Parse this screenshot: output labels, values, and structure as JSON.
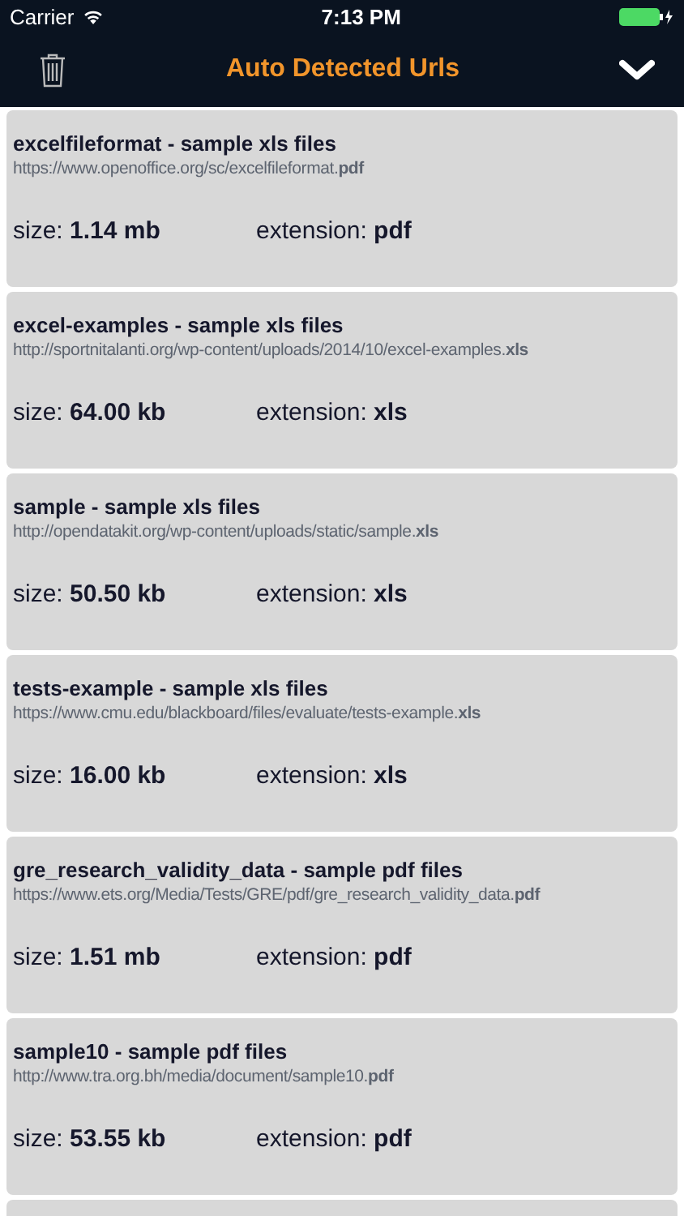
{
  "status_bar": {
    "carrier": "Carrier",
    "time": "7:13 PM"
  },
  "nav_bar": {
    "title": "Auto Detected Urls"
  },
  "items": [
    {
      "title": "excelfileformat - sample xls files",
      "url": "https://www.openoffice.org/sc/excelfileformat.**pdf**",
      "size": "size: **1.14 mb**",
      "extension": "extension: **pdf**"
    },
    {
      "title": "excel-examples - sample xls files",
      "url": "http://sportnitalanti.org/wp-content/uploads/2014/10/excel-examples.**xls**",
      "size": "size: **64.00 kb**",
      "extension": "extension: **xls**"
    },
    {
      "title": "sample - sample xls files",
      "url": "http://opendatakit.org/wp-content/uploads/static/sample.**xls**",
      "size": "size: **50.50 kb**",
      "extension": "extension: **xls**"
    },
    {
      "title": "tests-example - sample xls files",
      "url": "https://www.cmu.edu/blackboard/files/evaluate/tests-example.**xls**",
      "size": "size: **16.00 kb**",
      "extension": "extension: **xls**"
    },
    {
      "title": "gre_research_validity_data - sample pdf files",
      "url": "https://www.ets.org/Media/Tests/GRE/pdf/gre_research_validity_data.**pdf**",
      "size": "size: **1.51 mb**",
      "extension": "extension: **pdf**"
    },
    {
      "title": "sample10 - sample pdf files",
      "url": "http://www.tra.org.bh/media/document/sample10.**pdf**",
      "size": "size: **53.55 kb**",
      "extension": "extension: **pdf**"
    }
  ]
}
